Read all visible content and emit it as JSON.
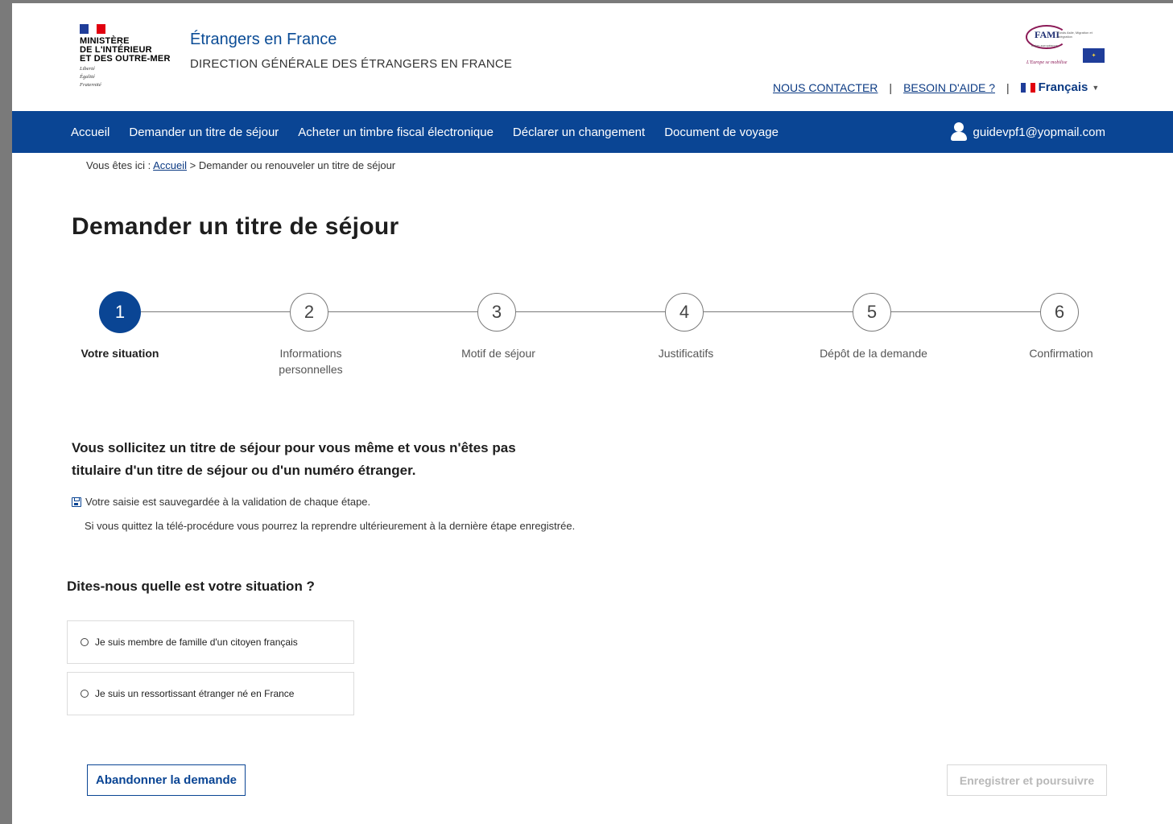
{
  "header": {
    "ministry_lines": [
      "MINISTÈRE",
      "DE L'INTÉRIEUR",
      "ET DES OUTRE-MER"
    ],
    "motto_lines": [
      "Liberté",
      "Égalité",
      "Fraternité"
    ],
    "site_title": "Étrangers en France",
    "site_subtitle": "DIRECTION GÉNÉRALE DES ÉTRANGERS EN FRANCE",
    "fami_logo": {
      "name": "FAMI",
      "subtitle": "Fonds Asile, Migration et Intégration",
      "union_text": "Union européenne",
      "tagline": "L'Europe se mobilise"
    },
    "contact_link": "NOUS CONTACTER",
    "help_link": "BESOIN D'AIDE ?",
    "separator": "|",
    "language": "Français"
  },
  "nav": {
    "items": [
      "Accueil",
      "Demander un titre de séjour",
      "Acheter un timbre fiscal électronique",
      "Déclarer un changement",
      "Document de voyage"
    ],
    "user_email": "guidevpf1@yopmail.com"
  },
  "breadcrumb": {
    "prefix": "Vous êtes ici :",
    "home": "Accueil",
    "current": "> Demander ou renouveler un titre de séjour"
  },
  "page_title": "Demander un titre de séjour",
  "steps": [
    {
      "number": "1",
      "label": "Votre situation",
      "active": true
    },
    {
      "number": "2",
      "label": "Informations personnelles",
      "active": false
    },
    {
      "number": "3",
      "label": "Motif de séjour",
      "active": false
    },
    {
      "number": "4",
      "label": "Justificatifs",
      "active": false
    },
    {
      "number": "5",
      "label": "Dépôt de la demande",
      "active": false
    },
    {
      "number": "6",
      "label": "Confirmation",
      "active": false
    }
  ],
  "intro_text": "Vous sollicitez un titre de séjour pour vous même et vous n'êtes pas titulaire d'un titre de séjour ou d'un numéro étranger.",
  "save_note": "Votre saisie est sauvegardée à la validation de chaque étape.",
  "resume_note": "Si vous quittez la télé-procédure vous pourrez la reprendre ultérieurement à la dernière étape enregistrée.",
  "question": "Dites-nous quelle est votre situation ?",
  "options": [
    "Je suis membre de famille d'un citoyen français",
    "Je suis un ressortissant étranger né en France"
  ],
  "buttons": {
    "abandon": "Abandonner la demande",
    "continue": "Enregistrer et poursuivre"
  },
  "colors": {
    "primary": "#0a4594",
    "link": "#0b3a83",
    "disabled": "#b8b8b8"
  }
}
